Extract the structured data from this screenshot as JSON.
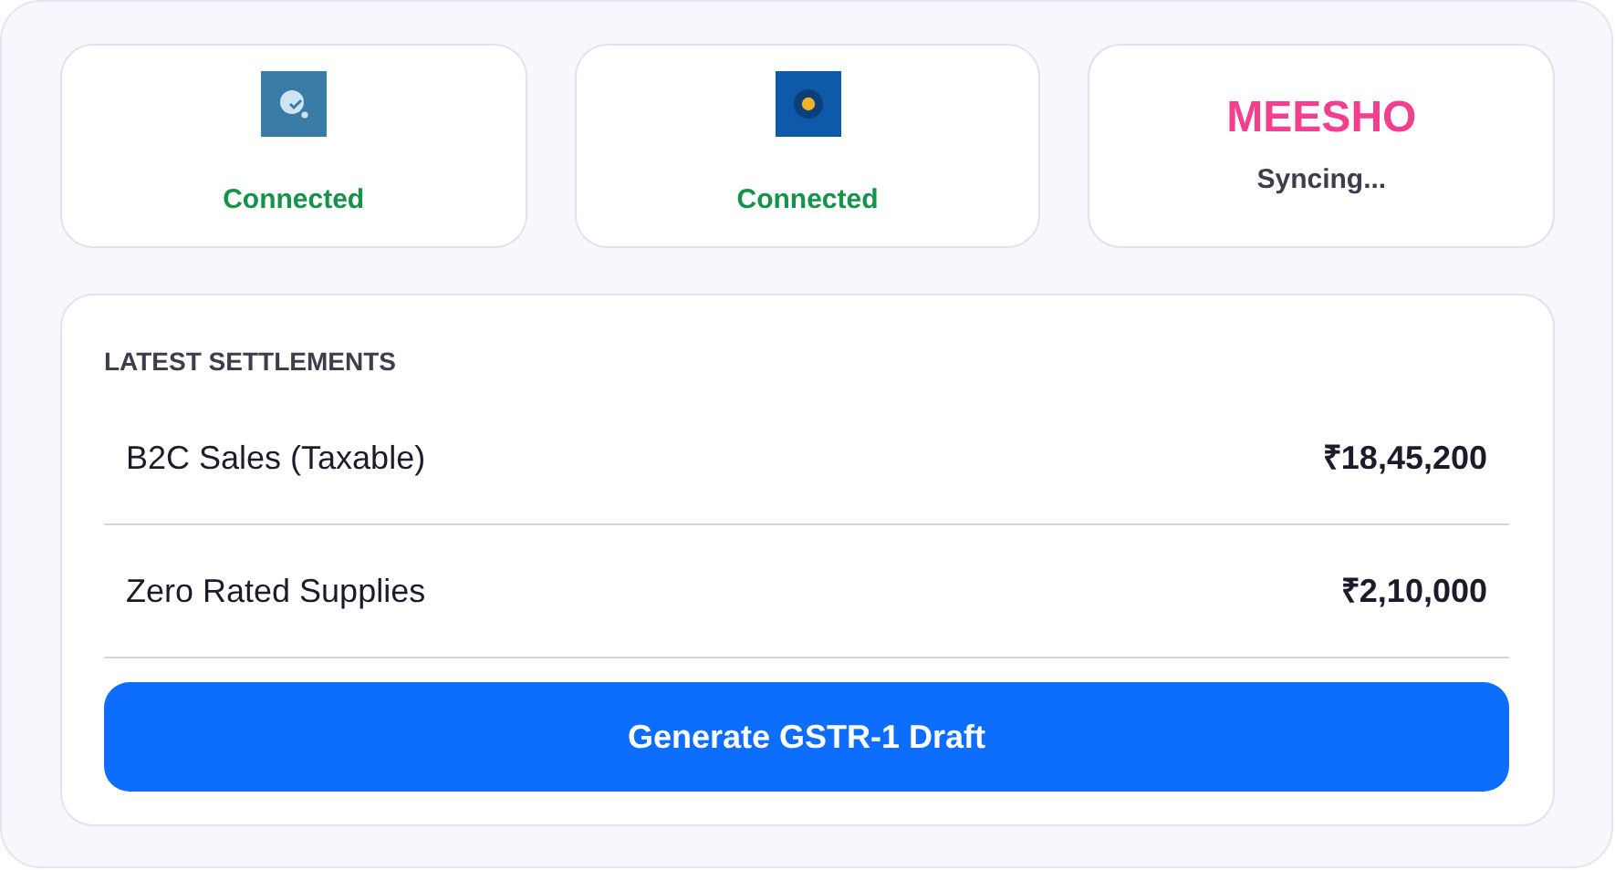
{
  "integrations": [
    {
      "kind": "bubble",
      "status": "Connected",
      "color": "#16934a"
    },
    {
      "kind": "coin",
      "status": "Connected",
      "color": "#16934a"
    },
    {
      "kind": "wordmark",
      "wordmark": "MEESHO",
      "status": "Syncing...",
      "color": "#3d3d4d"
    }
  ],
  "settlements": {
    "title": "LATEST SETTLEMENTS",
    "rows": [
      {
        "label": "B2C Sales (Taxable)",
        "amount": "₹18,45,200"
      },
      {
        "label": "Zero Rated Supplies",
        "amount": "₹2,10,000"
      }
    ]
  },
  "button": "Generate GSTR-1 Draft"
}
